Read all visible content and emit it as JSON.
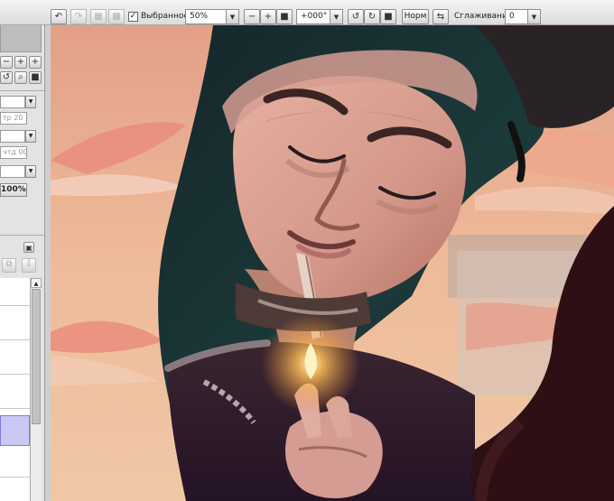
{
  "toolbar": {
    "selection_checked": true,
    "selection_label": "Выбранное",
    "zoom_value": "50%",
    "zoom_minus": "−",
    "zoom_plus": "+",
    "rotation_value": "+000°",
    "blend_mode_label": "Норм",
    "smoothing_label": "Сглаживание",
    "smoothing_value": "0",
    "checkmark": "✓",
    "dropdown_arrow": "▼"
  },
  "panel": {
    "zoom_minus": "−",
    "zoom_plus": "+",
    "field_1": "тр 20",
    "field_2": "чтд 00",
    "opacity_value": "100%"
  },
  "icons": {
    "undo": "undo-icon",
    "redo": "redo-icon",
    "zoom_out": "zoom-out-icon",
    "zoom_in": "zoom-in-icon",
    "rotate_left": "rotate-left-icon",
    "rotate_right": "rotate-right-icon",
    "flip": "flip-horizontal-icon"
  },
  "colors": {
    "sky_top": "#e6a48b",
    "sky_bottom": "#efc6a3",
    "hair": "#1b2a2b",
    "skin": "#d99e8f",
    "dark_figure": "#2e0f13",
    "selection_highlight": "#c9c9f3"
  }
}
